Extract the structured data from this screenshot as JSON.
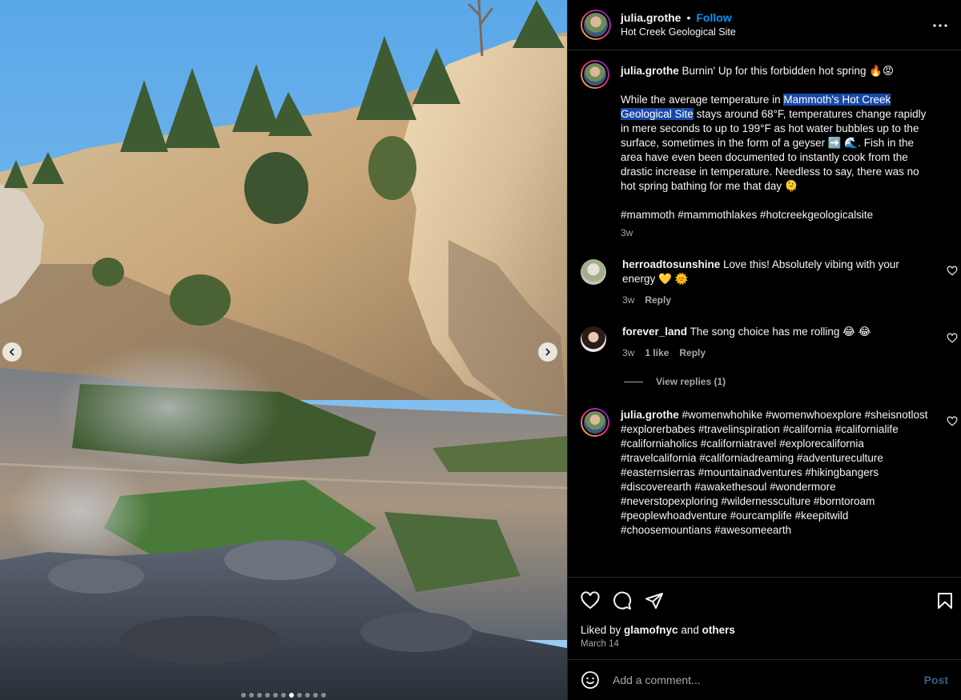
{
  "header": {
    "username": "julia.grothe",
    "separator": "•",
    "follow_label": "Follow",
    "location": "Hot Creek Geological Site"
  },
  "caption": {
    "username": "julia.grothe",
    "headline": "Burnin' Up for this forbidden hot spring 🔥😡",
    "body_pre": "While the average temperature in ",
    "body_highlight": "Mammoth's Hot Creek Geological Site",
    "body_post": " stays around 68°F, temperatures change rapidly in mere seconds to up to 199°F as hot water bubbles up to the surface, sometimes in the form of a geyser ➡️ 🌊. Fish in the area have even been documented to instantly cook from the drastic increase in temperature. Needless to say, there was no hot spring bathing for me that day 🫠",
    "hashtags": "#mammoth #mammothlakes #hotcreekgeologicalsite",
    "time": "3w"
  },
  "comments": [
    {
      "username": "herroadtosunshine",
      "text": "Love this! Absolutely vibing with your energy 💛 🌞",
      "time": "3w",
      "reply_label": "Reply"
    },
    {
      "username": "forever_land",
      "text": "The song choice has me rolling 😂 😂",
      "time": "3w",
      "likes": "1 like",
      "reply_label": "Reply"
    }
  ],
  "view_replies_label": "View replies (1)",
  "hashtag_comment": {
    "username": "julia.grothe",
    "text": "#womenwhohike #womenwhoexplore #sheisnotlost #explorerbabes #travelinspiration #california #californialife #californiaholics #californiatravel #explorecalifornia #travelcalifornia #californiadreaming #adventureculture #easternsierras #mountainadventures #hikingbangers #discoverearth #awakethesoul #wondermore #neverstopexploring #wildernessculture #borntoroam #peoplewhoadventure #ourcamplife #keepitwild #choosemountians #awesomeearth"
  },
  "likes": {
    "prefix": "Liked by ",
    "user": "glamofnyc",
    "mid": " and ",
    "others": "others",
    "date": "March 14"
  },
  "comment_box": {
    "placeholder": "Add a comment...",
    "post_label": "Post"
  },
  "carousel": {
    "total": 11,
    "active_index": 7
  },
  "icons": {
    "header_more": "more-horizontal-icon",
    "like": "heart-icon",
    "comment": "comment-bubble-icon",
    "share": "paper-plane-icon",
    "save": "bookmark-icon",
    "emoji": "smiley-icon",
    "prev": "chevron-left-icon",
    "next": "chevron-right-icon"
  },
  "colors": {
    "background": "#000000",
    "follow_blue": "#0095f6",
    "highlight": "#1849a9",
    "muted": "#a8a8a8",
    "post_disabled": "#3a5f85"
  }
}
